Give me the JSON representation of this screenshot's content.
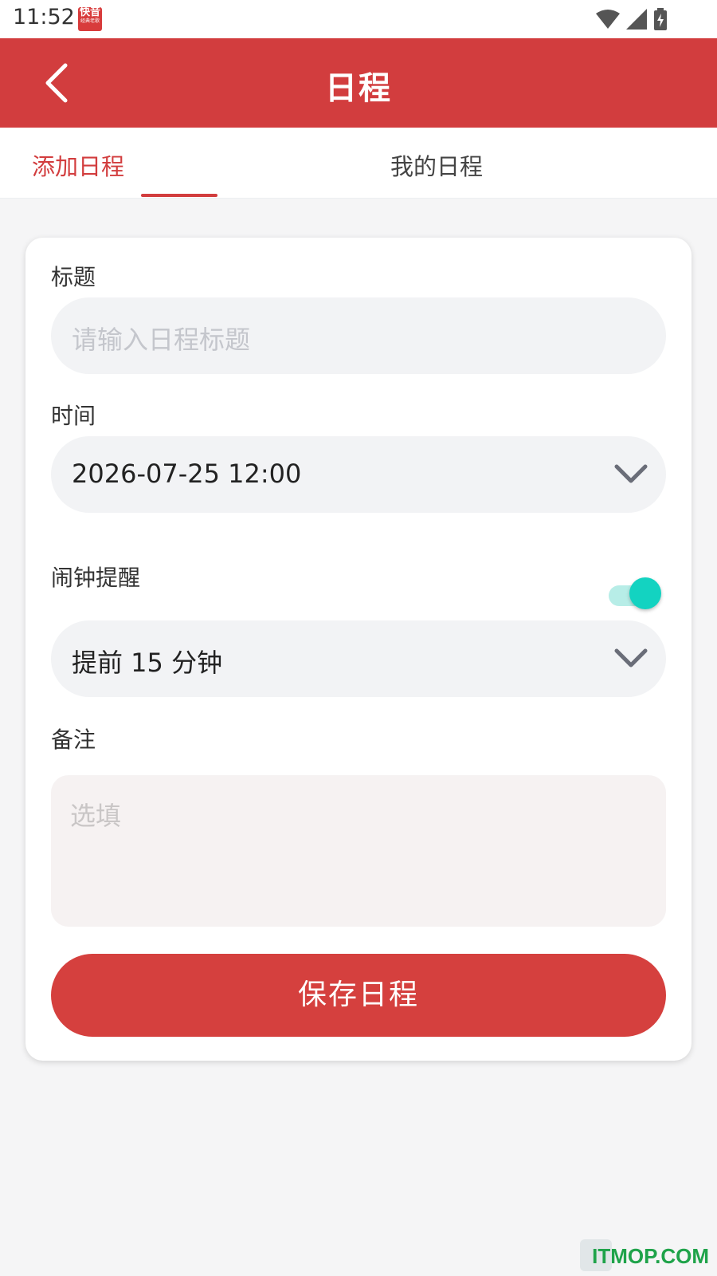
{
  "status_bar": {
    "time": "11:52",
    "app_badge": "快音",
    "app_badge_sub": "经典老歌"
  },
  "app_bar": {
    "title": "日程"
  },
  "tabs": [
    {
      "label": "添加日程"
    },
    {
      "label": "我的日程"
    }
  ],
  "form": {
    "title_label": "标题",
    "title_placeholder": "请输入日程标题",
    "time_label": "时间",
    "time_value": "2026-07-25 12:00",
    "alarm_label": "闹钟提醒",
    "alarm_enabled": true,
    "reminder_value": "提前 15 分钟",
    "notes_label": "备注",
    "notes_placeholder": "选填",
    "save_label": "保存日程"
  },
  "watermark": "ITMOP.COM",
  "colors": {
    "primary": "#d23d3e",
    "toggle": "#13d3c1"
  }
}
